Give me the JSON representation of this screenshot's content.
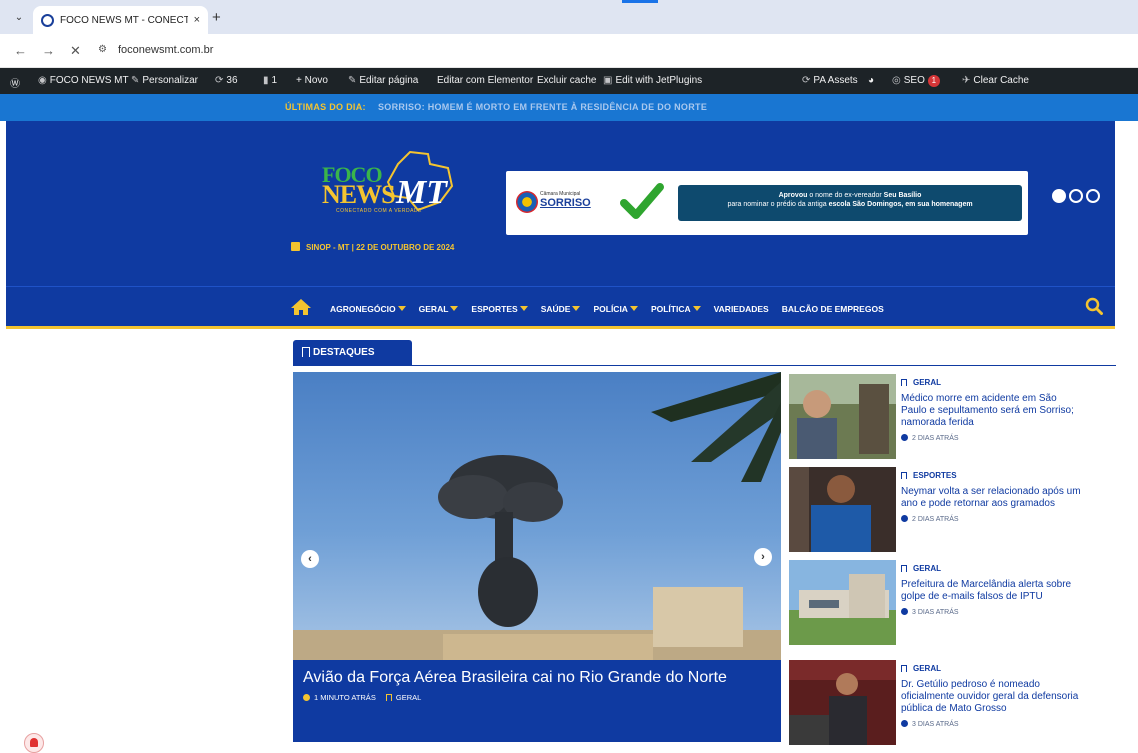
{
  "browser": {
    "tab_title": "FOCO NEWS MT - CONECTADO",
    "close_glyph": "×",
    "newtab_glyph": "+",
    "dropdown_glyph": "⌄",
    "back_glyph": "←",
    "forward_glyph": "→",
    "stop_glyph": "✕",
    "url": "foconewsmt.com.br"
  },
  "admin_bar": {
    "site_name": "FOCO NEWS MT",
    "customize": "Personalizar",
    "updates": "36",
    "comments": "1",
    "new": "+ Novo",
    "edit_page": "Editar página",
    "edit_elementor": "Editar com Elementor",
    "clear_cache": "Excluir cache",
    "jetplugins": "Edit with JetPlugins",
    "pa_assets": "PA Assets",
    "seo": "SEO",
    "seo_count": "1",
    "clear_cache_en": "Clear Cache"
  },
  "ticker": {
    "label": "ÚLTIMAS DO DIA:",
    "text": "SORRISO: HOMEM É MORTO EM FRENTE À RESIDÊNCIA DE DO NORTE"
  },
  "logo": {
    "foco": "FOCO",
    "news": "NEWS",
    "mt": "MT",
    "tagline": "CONECTADO COM A VERDADE"
  },
  "date_line": "SINOP - MT | 22 DE OUTUBRO DE 2024",
  "banner": {
    "org_small": "Câmara Municipal",
    "org_name": "SORRISO",
    "line1_bold": "Aprovou",
    "line1_rest": "o nome do ex-vereador",
    "line1_name": "Seu Basílio",
    "line2_rest": "para nominar o prédio da antiga",
    "line2_bold": "escola São Domingos, em sua homenagem"
  },
  "menu": {
    "items": [
      {
        "label": "AGRONEGÓCIO",
        "dropdown": true
      },
      {
        "label": "GERAL",
        "dropdown": true
      },
      {
        "label": "ESPORTES",
        "dropdown": true
      },
      {
        "label": "SAÚDE",
        "dropdown": true
      },
      {
        "label": "POLÍCIA",
        "dropdown": true
      },
      {
        "label": "POLÍTICA",
        "dropdown": true
      },
      {
        "label": "VARIEDADES",
        "dropdown": false
      },
      {
        "label": "BALCÃO DE EMPREGOS",
        "dropdown": false
      }
    ]
  },
  "section": {
    "title": "DESTAQUES"
  },
  "hero": {
    "title": "Avião da Força Aérea Brasileira cai no Rio Grande do Norte",
    "time": "1 MINUTO ATRÁS",
    "category": "GERAL",
    "prev_glyph": "‹",
    "next_glyph": "›"
  },
  "side_news": [
    {
      "category": "GERAL",
      "title": "Médico morre em acidente em São Paulo e sepultamento será em Sorriso; namorada ferida",
      "time": "2 DIAS ATRÁS"
    },
    {
      "category": "ESPORTES",
      "title": "Neymar volta a ser relacionado após um ano e pode retornar aos gramados",
      "time": "2 DIAS ATRÁS"
    },
    {
      "category": "GERAL",
      "title": "Prefeitura de Marcelândia alerta sobre golpe de e-mails falsos de IPTU",
      "time": "3 DIAS ATRÁS"
    },
    {
      "category": "GERAL",
      "title": "Dr. Getúlio pedroso é nomeado oficialmente ouvidor geral da defensoria pública de Mato Grosso",
      "time": "3 DIAS ATRÁS"
    }
  ],
  "colors": {
    "brand_blue": "#0f3aa1",
    "ticker_blue": "#1976d2",
    "accent_yellow": "#f4c430"
  }
}
